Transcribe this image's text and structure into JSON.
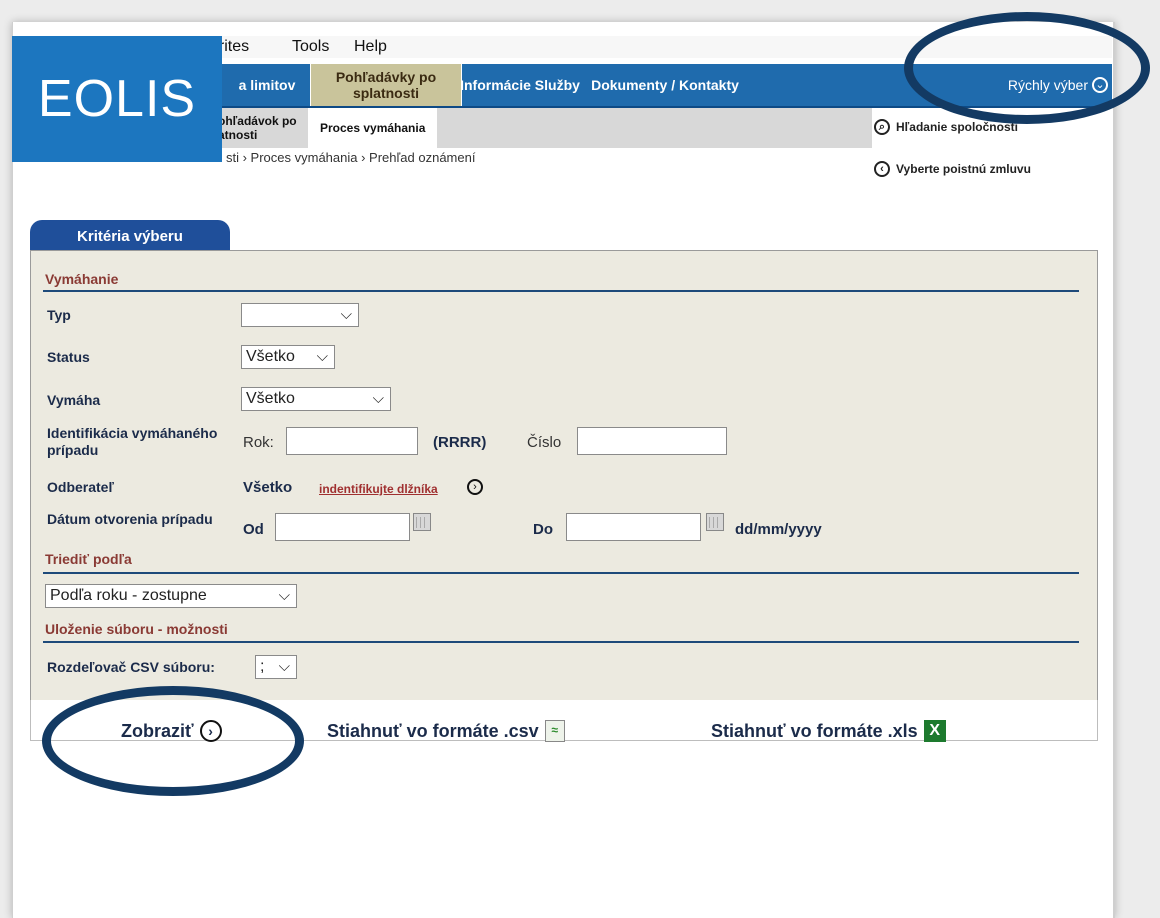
{
  "menubar": {
    "items": [
      "vorites",
      "Tools",
      "Help"
    ]
  },
  "nav": {
    "tabs": [
      {
        "label": "a limitov"
      },
      {
        "label": "Pohľadávky po splatnosti"
      },
      {
        "label": "Informácie Služby"
      },
      {
        "label": "Dokumenty / Kontakty"
      }
    ],
    "quick_select": "Rýchly výber"
  },
  "subnav": {
    "items": [
      "ohľadávok po atnosti",
      "Proces vymáhania"
    ]
  },
  "logo": {
    "text": "EOLIS"
  },
  "breadcrumb": "sti › Proces vymáhania › Prehľad oznámení",
  "side_links": {
    "search_company": "Hľadanie spoločnosti",
    "select_policy": "Vyberte poistnú zmluvu"
  },
  "criteria": {
    "tab_label": "Kritéria výberu",
    "section_enforcement": "Vymáhanie",
    "typ": {
      "label": "Typ",
      "value": ""
    },
    "status": {
      "label": "Status",
      "value": "Všetko"
    },
    "vymaha": {
      "label": "Vymáha",
      "value": "Všetko"
    },
    "case_id": {
      "label": "Identifikácia vymáhaného prípadu",
      "year_label": "Rok:",
      "year_format": "(RRRR)",
      "number_label": "Číslo"
    },
    "customer": {
      "label": "Odberateľ",
      "value": "Všetko",
      "link": "indentifikujte dlžníka"
    },
    "opened_date": {
      "label": "Dátum otvorenia prípadu",
      "from_label": "Od",
      "to_label": "Do",
      "format": "dd/mm/yyyy"
    },
    "section_sort": "Triediť podľa",
    "sort_value": "Podľa roku - zostupne",
    "section_save": "Uloženie súboru - možnosti",
    "csv_separator": {
      "label": "Rozdeľovač CSV súboru:",
      "value": ";"
    }
  },
  "actions": {
    "show": "Zobraziť",
    "download_csv": "Stiahnuť vo formáte .csv",
    "download_xls": "Stiahnuť vo formáte .xls"
  }
}
